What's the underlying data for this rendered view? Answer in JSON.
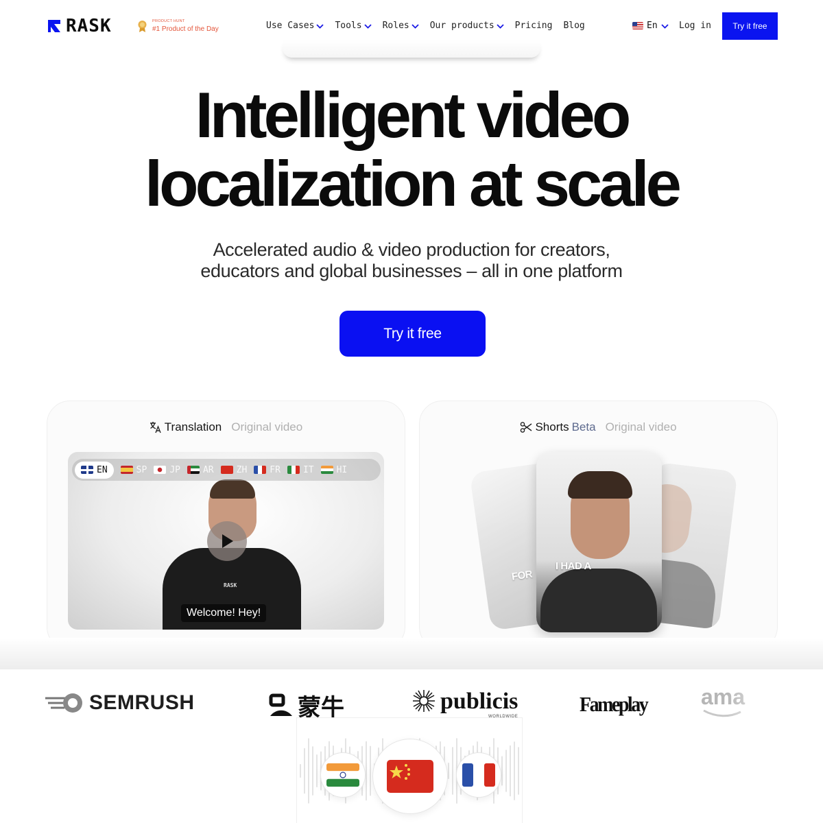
{
  "header": {
    "brand": "RASK",
    "product_hunt": {
      "small": "PRODUCT HUNT",
      "big": "#1 Product of the Day"
    },
    "nav": [
      {
        "label": "Use Cases",
        "dropdown": true
      },
      {
        "label": "Tools",
        "dropdown": true
      },
      {
        "label": "Roles",
        "dropdown": true
      },
      {
        "label": "Our products",
        "dropdown": true
      },
      {
        "label": "Pricing",
        "dropdown": false
      },
      {
        "label": "Blog",
        "dropdown": false
      }
    ],
    "language": "En",
    "login": "Log in",
    "cta": "Try it free"
  },
  "hero": {
    "title_line1": "Intelligent video",
    "title_line2": "localization at scale",
    "subtitle_line1": "Accelerated audio & video production for creators,",
    "subtitle_line2": "educators and global businesses – all in one platform",
    "cta": "Try it free"
  },
  "cards": {
    "translation": {
      "tab_active": "Translation",
      "tab_inactive": "Original video",
      "languages": [
        "EN",
        "SP",
        "JP",
        "AR",
        "ZH",
        "FR",
        "IT",
        "HI"
      ],
      "selected_language": "EN",
      "caption": "Welcome! Hey!",
      "shirt_brand": "RASK"
    },
    "shorts": {
      "tab_active": "Shorts",
      "tab_beta": "Beta",
      "tab_inactive": "Original video",
      "left_caption": "FOR",
      "center_caption": "I HAD A"
    }
  },
  "logos": {
    "semrush": "SEMRUSH",
    "mengniu": "蒙牛",
    "publicis": "publicis",
    "publicis_sub": "WORLDWIDE",
    "fameplay": "Fameplay",
    "amazon_partial": "ama"
  },
  "colors": {
    "accent": "#0a10f2",
    "product_hunt": "#e4553a",
    "text": "#0b0b0b",
    "muted_tab": "#b0b0b0"
  }
}
